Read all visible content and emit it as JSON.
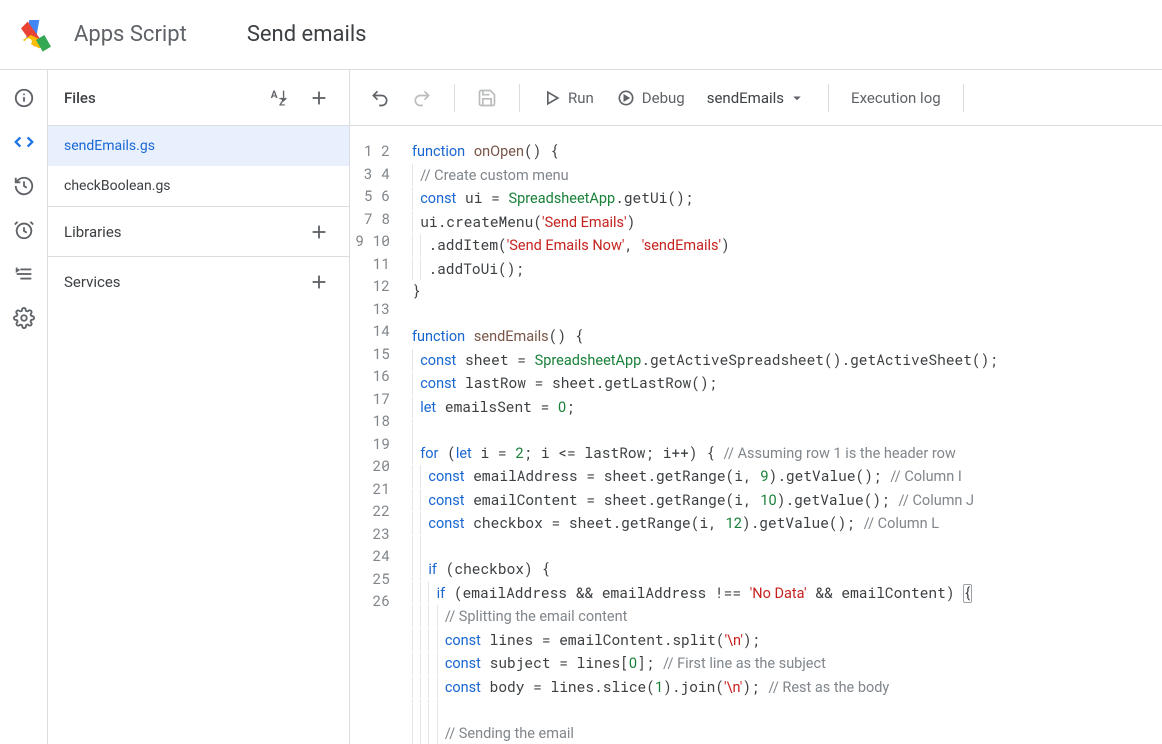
{
  "header": {
    "app_title": "Apps Script",
    "project_name": "Send emails"
  },
  "rail": [
    {
      "name": "info-icon",
      "active": false
    },
    {
      "name": "code-icon",
      "active": true
    },
    {
      "name": "history-icon",
      "active": false
    },
    {
      "name": "alarm-icon",
      "active": false
    },
    {
      "name": "list-icon",
      "active": false
    },
    {
      "name": "gear-icon",
      "active": false
    }
  ],
  "files_panel": {
    "title": "Files",
    "files": [
      {
        "name": "sendEmails.gs",
        "active": true
      },
      {
        "name": "checkBoolean.gs",
        "active": false
      }
    ],
    "sections": [
      {
        "label": "Libraries"
      },
      {
        "label": "Services"
      }
    ]
  },
  "toolbar": {
    "run": "Run",
    "debug": "Debug",
    "selected_function": "sendEmails",
    "exec_log": "Execution log"
  },
  "code": {
    "start": 1,
    "end": 26,
    "lines": [
      [
        [
          "kw",
          "function"
        ],
        [
          "p",
          " "
        ],
        [
          "fn",
          "onOpen"
        ],
        [
          "p",
          "() {"
        ]
      ],
      [
        [
          "i",
          1
        ],
        [
          "cmt",
          "// Create custom menu"
        ]
      ],
      [
        [
          "i",
          1
        ],
        [
          "kw",
          "const"
        ],
        [
          "p",
          " ui = "
        ],
        [
          "cls",
          "SpreadsheetApp"
        ],
        [
          "p",
          ".getUi();"
        ]
      ],
      [
        [
          "i",
          1
        ],
        [
          "p",
          "ui.createMenu("
        ],
        [
          "str",
          "'Send Emails'"
        ],
        [
          "p",
          ")"
        ]
      ],
      [
        [
          "i",
          2
        ],
        [
          "p",
          ".addItem("
        ],
        [
          "str",
          "'Send Emails Now'"
        ],
        [
          "p",
          ", "
        ],
        [
          "str",
          "'sendEmails'"
        ],
        [
          "p",
          ")"
        ]
      ],
      [
        [
          "i",
          2
        ],
        [
          "p",
          ".addToUi();"
        ]
      ],
      [
        [
          "p",
          "}"
        ]
      ],
      [
        [
          "p",
          ""
        ]
      ],
      [
        [
          "kw",
          "function"
        ],
        [
          "p",
          " "
        ],
        [
          "fn",
          "sendEmails"
        ],
        [
          "p",
          "() {"
        ]
      ],
      [
        [
          "i",
          1
        ],
        [
          "kw",
          "const"
        ],
        [
          "p",
          " sheet = "
        ],
        [
          "cls",
          "SpreadsheetApp"
        ],
        [
          "p",
          ".getActiveSpreadsheet().getActiveSheet();"
        ]
      ],
      [
        [
          "i",
          1
        ],
        [
          "kw",
          "const"
        ],
        [
          "p",
          " lastRow = sheet.getLastRow();"
        ]
      ],
      [
        [
          "i",
          1
        ],
        [
          "kw",
          "let"
        ],
        [
          "p",
          " emailsSent = "
        ],
        [
          "num",
          "0"
        ],
        [
          "p",
          ";"
        ]
      ],
      [
        [
          "i",
          1
        ],
        [
          "p",
          ""
        ]
      ],
      [
        [
          "i",
          1
        ],
        [
          "kw",
          "for"
        ],
        [
          "p",
          " ("
        ],
        [
          "kw",
          "let"
        ],
        [
          "p",
          " i = "
        ],
        [
          "num",
          "2"
        ],
        [
          "p",
          "; i <= lastRow; i++) { "
        ],
        [
          "cmt",
          "// Assuming row 1 is the header row"
        ]
      ],
      [
        [
          "i",
          2
        ],
        [
          "kw",
          "const"
        ],
        [
          "p",
          " emailAddress = sheet.getRange(i, "
        ],
        [
          "num",
          "9"
        ],
        [
          "p",
          ").getValue(); "
        ],
        [
          "cmt",
          "// Column I"
        ]
      ],
      [
        [
          "i",
          2
        ],
        [
          "kw",
          "const"
        ],
        [
          "p",
          " emailContent = sheet.getRange(i, "
        ],
        [
          "num",
          "10"
        ],
        [
          "p",
          ").getValue(); "
        ],
        [
          "cmt",
          "// Column J"
        ]
      ],
      [
        [
          "i",
          2
        ],
        [
          "kw",
          "const"
        ],
        [
          "p",
          " checkbox = sheet.getRange(i, "
        ],
        [
          "num",
          "12"
        ],
        [
          "p",
          ").getValue(); "
        ],
        [
          "cmt",
          "// Column L"
        ]
      ],
      [
        [
          "i",
          2
        ],
        [
          "p",
          ""
        ]
      ],
      [
        [
          "i",
          2
        ],
        [
          "kw",
          "if"
        ],
        [
          "p",
          " (checkbox) {"
        ]
      ],
      [
        [
          "i",
          3
        ],
        [
          "kw",
          "if"
        ],
        [
          "p",
          " (emailAddress && emailAddress !== "
        ],
        [
          "str",
          "'No Data'"
        ],
        [
          "p",
          " && emailContent) "
        ],
        [
          "hl",
          "{"
        ]
      ],
      [
        [
          "i",
          4
        ],
        [
          "cmt",
          "// Splitting the email content"
        ]
      ],
      [
        [
          "i",
          4
        ],
        [
          "kw",
          "const"
        ],
        [
          "p",
          " lines = emailContent.split("
        ],
        [
          "str",
          "'\\n'"
        ],
        [
          "p",
          ");"
        ]
      ],
      [
        [
          "i",
          4
        ],
        [
          "kw",
          "const"
        ],
        [
          "p",
          " subject = lines["
        ],
        [
          "num",
          "0"
        ],
        [
          "p",
          "]; "
        ],
        [
          "cmt",
          "// First line as the subject"
        ]
      ],
      [
        [
          "i",
          4
        ],
        [
          "kw",
          "const"
        ],
        [
          "p",
          " body = lines.slice("
        ],
        [
          "num",
          "1"
        ],
        [
          "p",
          ").join("
        ],
        [
          "str",
          "'\\n'"
        ],
        [
          "p",
          "); "
        ],
        [
          "cmt",
          "// Rest as the body"
        ]
      ],
      [
        [
          "i",
          4
        ],
        [
          "p",
          ""
        ]
      ],
      [
        [
          "i",
          4
        ],
        [
          "cmt",
          "// Sending the email"
        ]
      ]
    ]
  }
}
